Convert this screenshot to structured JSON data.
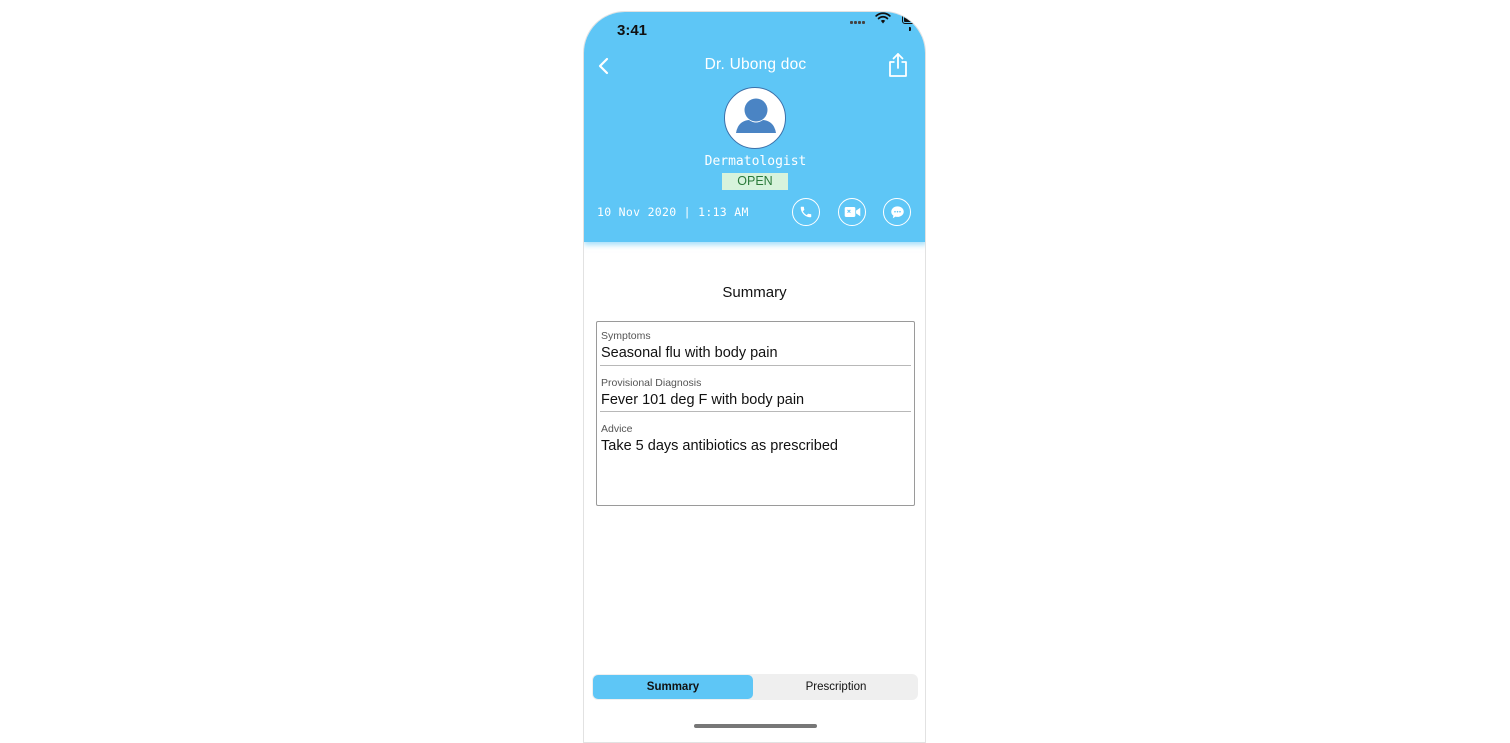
{
  "status_bar": {
    "time": "3:41"
  },
  "header": {
    "title": "Dr. Ubong doc",
    "specialty": "Dermatologist",
    "status": "OPEN",
    "datetime": "10 Nov 2020 | 1:13 AM",
    "accent_color": "#5ec6f6",
    "status_badge_color": "#d7f3dc"
  },
  "icons": {
    "back": "chevron-left-icon",
    "share": "share-icon",
    "avatar": "person-avatar-icon",
    "call": "phone-icon",
    "video": "video-camera-icon",
    "chat": "chat-bubble-icon"
  },
  "main": {
    "section_title": "Summary",
    "fields": [
      {
        "label": "Symptoms",
        "value": "Seasonal flu with body pain"
      },
      {
        "label": "Provisional Diagnosis",
        "value": "Fever 101 deg F with body pain"
      },
      {
        "label": "Advice",
        "value": "Take 5 days antibiotics as prescribed"
      }
    ]
  },
  "tabs": [
    {
      "label": "Summary",
      "selected": true
    },
    {
      "label": "Prescription",
      "selected": false
    }
  ]
}
